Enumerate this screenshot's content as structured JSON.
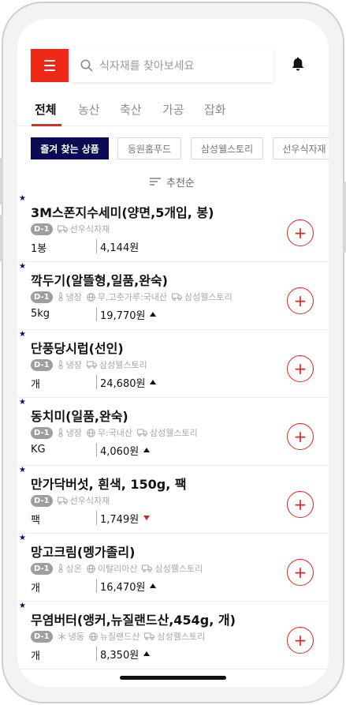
{
  "header": {
    "search_placeholder": "식자재를 찾아보세요"
  },
  "tabs": [
    {
      "label": "전체",
      "active": true
    },
    {
      "label": "농산",
      "active": false
    },
    {
      "label": "축산",
      "active": false
    },
    {
      "label": "가공",
      "active": false
    },
    {
      "label": "잡화",
      "active": false
    }
  ],
  "chips": [
    {
      "label": "즐겨 찾는 상품",
      "active": true
    },
    {
      "label": "동원홈푸드",
      "active": false
    },
    {
      "label": "삼성웰스토리",
      "active": false
    },
    {
      "label": "선우식자재",
      "active": false
    }
  ],
  "sort": {
    "label": "추천순"
  },
  "products": [
    {
      "name": "3M스폰지수세미(양면,5개입, 봉)",
      "badge": "D-1",
      "storage": "",
      "origin": "",
      "supplier": "선우식자재",
      "unit": "1봉",
      "price": "4,144원",
      "trend": "none"
    },
    {
      "name": "깍두기(알뜰형,일품,완숙)",
      "badge": "D-1",
      "storage": "냉장",
      "origin": "무,고춧가루:국내산",
      "supplier": "삼성웰스토리",
      "unit": "5kg",
      "price": "19,770원",
      "trend": "up"
    },
    {
      "name": "단풍당시럽(선인)",
      "badge": "D-1",
      "storage": "냉장",
      "origin": "",
      "supplier": "삼성웰스토리",
      "unit": "개",
      "price": "24,680원",
      "trend": "up"
    },
    {
      "name": "동치미(일품,완숙)",
      "badge": "D-1",
      "storage": "냉장",
      "origin": "무:국내산",
      "supplier": "삼성웰스토리",
      "unit": "KG",
      "price": "4,060원",
      "trend": "up"
    },
    {
      "name": "만가닥버섯, 흰색, 150g, 팩",
      "badge": "D-1",
      "storage": "",
      "origin": "",
      "supplier": "선우식자재",
      "unit": "팩",
      "price": "1,749원",
      "trend": "down"
    },
    {
      "name": "망고크림(멩가졸리)",
      "badge": "D-1",
      "storage": "상온",
      "origin": "이탈리아산",
      "supplier": "삼성웰스토리",
      "unit": "개",
      "price": "16,470원",
      "trend": "up"
    },
    {
      "name": "무염버터(앵커,뉴질랜드산,454g, 개)",
      "badge": "D-1",
      "storage": "냉동",
      "origin": "뉴질랜드산",
      "supplier": "삼성웰스토리",
      "unit": "개",
      "price": "8,350원",
      "trend": "up"
    }
  ],
  "colors": {
    "accent": "#ee2a17",
    "navy": "#0b0b55",
    "trend_down": "#e01c24"
  },
  "icons": {
    "menu": "hamburger-menu-icon",
    "search": "search-icon",
    "bell": "bell-icon",
    "sort": "sort-lines-icon",
    "favorite": "star-icon",
    "storage_cold": "thermometer-icon",
    "storage_frozen": "snowflake-icon",
    "origin": "globe-icon",
    "supplier": "truck-icon",
    "add": "plus-icon"
  }
}
